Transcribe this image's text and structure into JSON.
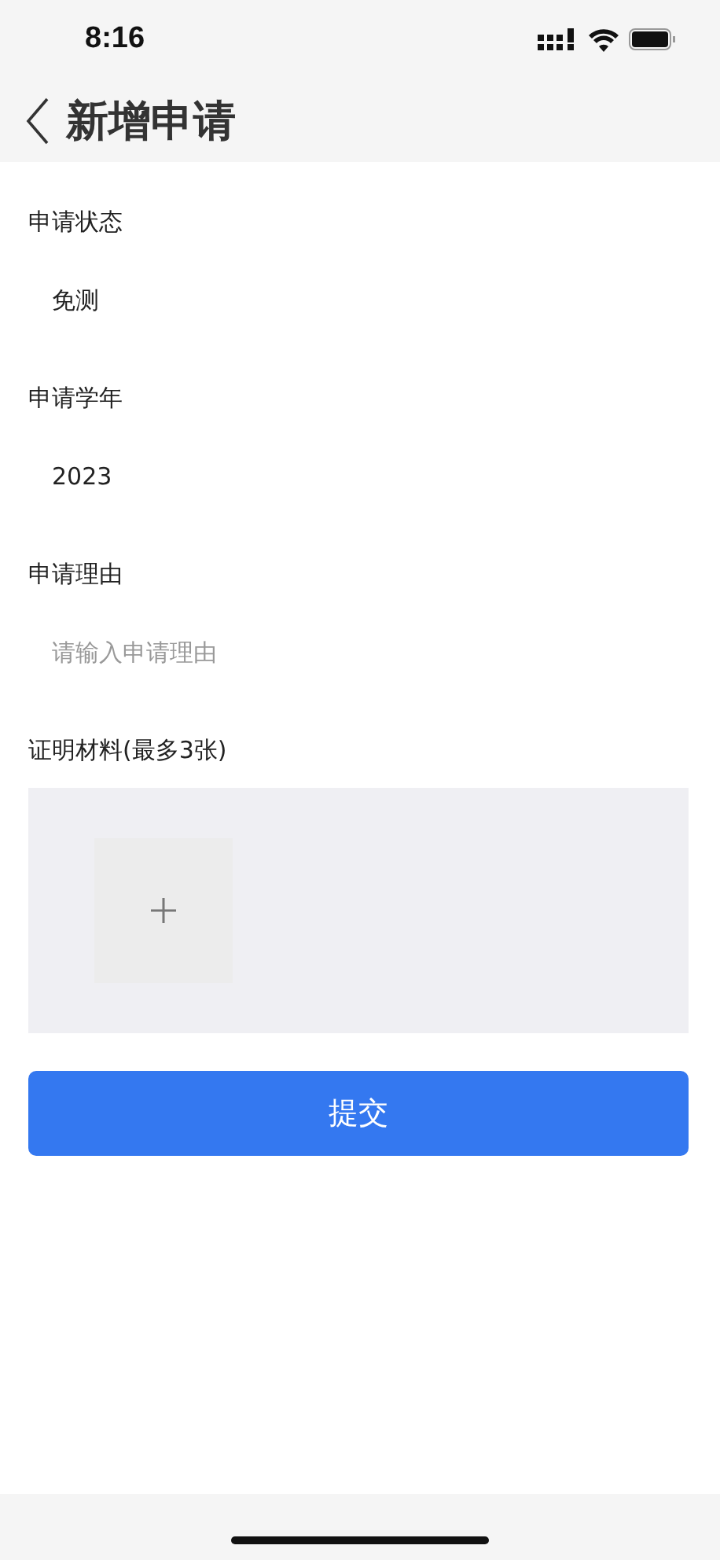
{
  "status_bar": {
    "time": "8:16"
  },
  "header": {
    "title": "新增申请"
  },
  "fields": [
    {
      "kind": "select",
      "label": "申请状态",
      "value": "免测"
    },
    {
      "kind": "select",
      "label": "申请学年",
      "value": "2023"
    },
    {
      "kind": "input",
      "label": "申请理由",
      "placeholder": "请输入申请理由"
    }
  ],
  "upload": {
    "label": "证明材料(最多3张)"
  },
  "submit_button": "提交"
}
